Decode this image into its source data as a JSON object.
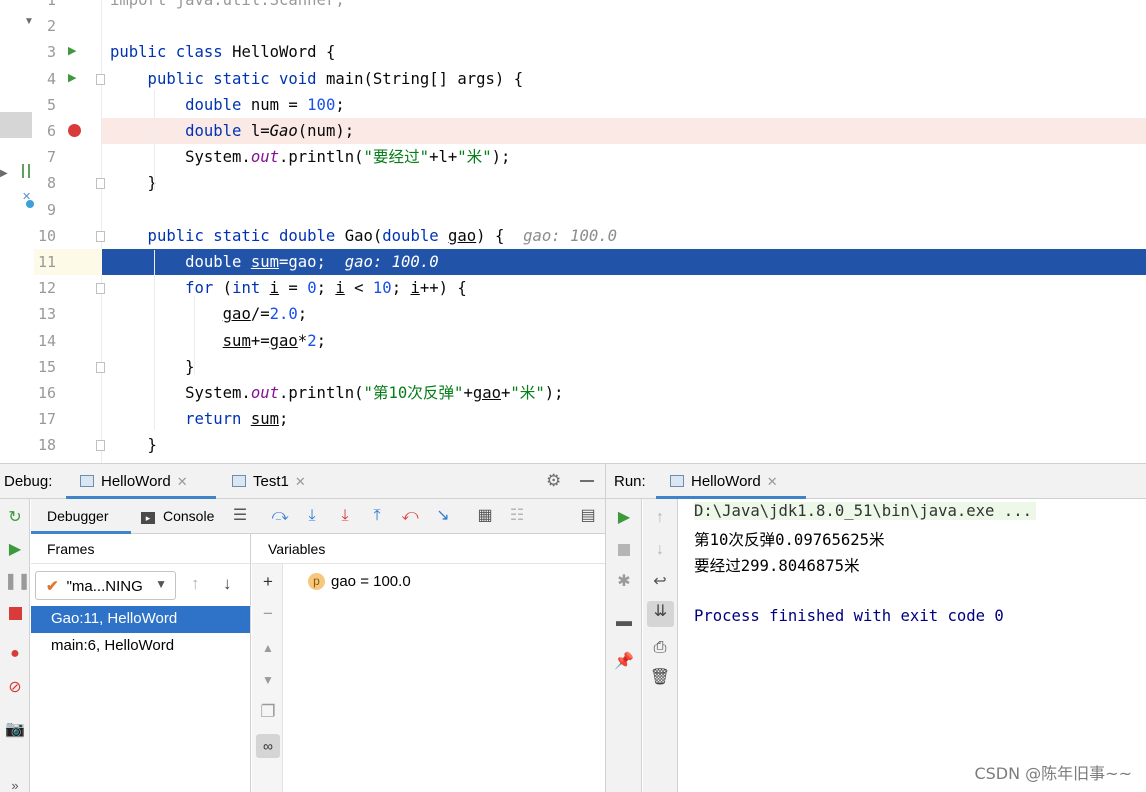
{
  "editor": {
    "lines": [
      {
        "n": "1",
        "tokens": [
          {
            "t": "import java.util.Scanner;",
            "c": "dim"
          }
        ]
      },
      {
        "n": "2",
        "tokens": []
      },
      {
        "n": "3",
        "tokens": [
          {
            "t": "public class ",
            "c": "kw"
          },
          {
            "t": "HelloWord {",
            "c": ""
          }
        ]
      },
      {
        "n": "4",
        "tokens": [
          {
            "t": "    public static void ",
            "c": "kw"
          },
          {
            "t": "main",
            "c": ""
          },
          {
            "t": "(String[] args) {",
            "c": ""
          }
        ]
      },
      {
        "n": "5",
        "tokens": [
          {
            "t": "        double ",
            "c": "kw"
          },
          {
            "t": "num = ",
            "c": ""
          },
          {
            "t": "100",
            "c": "num"
          },
          {
            "t": ";",
            "c": ""
          }
        ]
      },
      {
        "n": "6",
        "tokens": [
          {
            "t": "        double ",
            "c": "kw"
          },
          {
            "t": "l=",
            "c": ""
          },
          {
            "t": "Gao",
            "c": "ital"
          },
          {
            "t": "(num);",
            "c": ""
          }
        ]
      },
      {
        "n": "7",
        "tokens": [
          {
            "t": "        System.",
            "c": ""
          },
          {
            "t": "out",
            "c": "fld"
          },
          {
            "t": ".println(",
            "c": ""
          },
          {
            "t": "\"要经过\"",
            "c": "str"
          },
          {
            "t": "+l+",
            "c": ""
          },
          {
            "t": "\"米\"",
            "c": "str"
          },
          {
            "t": ");",
            "c": ""
          }
        ]
      },
      {
        "n": "8",
        "tokens": [
          {
            "t": "    }",
            "c": ""
          }
        ]
      },
      {
        "n": "9",
        "tokens": []
      },
      {
        "n": "10",
        "tokens": [
          {
            "t": "    public static double ",
            "c": "kw"
          },
          {
            "t": "Gao",
            "c": ""
          },
          {
            "t": "(",
            "c": ""
          },
          {
            "t": "double ",
            "c": "kw"
          },
          {
            "t": "gao",
            "c": "ul"
          },
          {
            "t": ") {  ",
            "c": ""
          },
          {
            "t": "gao: 100.0",
            "c": "hint"
          }
        ]
      },
      {
        "n": "11",
        "tokens": [
          {
            "t": "        double ",
            "c": "kw"
          },
          {
            "t": "sum",
            "c": "ul"
          },
          {
            "t": "=gao;  ",
            "c": ""
          },
          {
            "t": "gao: 100.0",
            "c": "hint"
          }
        ]
      },
      {
        "n": "12",
        "tokens": [
          {
            "t": "        for ",
            "c": "kw"
          },
          {
            "t": "(",
            "c": ""
          },
          {
            "t": "int ",
            "c": "kw"
          },
          {
            "t": "i",
            "c": "ul"
          },
          {
            "t": " = ",
            "c": ""
          },
          {
            "t": "0",
            "c": "num"
          },
          {
            "t": "; ",
            "c": ""
          },
          {
            "t": "i",
            "c": "ul"
          },
          {
            "t": " < ",
            "c": ""
          },
          {
            "t": "10",
            "c": "num"
          },
          {
            "t": "; ",
            "c": ""
          },
          {
            "t": "i",
            "c": "ul"
          },
          {
            "t": "++) {",
            "c": ""
          }
        ]
      },
      {
        "n": "13",
        "tokens": [
          {
            "t": "            ",
            "c": ""
          },
          {
            "t": "gao",
            "c": "ul"
          },
          {
            "t": "/=",
            "c": ""
          },
          {
            "t": "2.0",
            "c": "num"
          },
          {
            "t": ";",
            "c": ""
          }
        ]
      },
      {
        "n": "14",
        "tokens": [
          {
            "t": "            ",
            "c": ""
          },
          {
            "t": "sum",
            "c": "ul"
          },
          {
            "t": "+=",
            "c": ""
          },
          {
            "t": "gao",
            "c": "ul"
          },
          {
            "t": "*",
            "c": ""
          },
          {
            "t": "2",
            "c": "num"
          },
          {
            "t": ";",
            "c": ""
          }
        ]
      },
      {
        "n": "15",
        "tokens": [
          {
            "t": "        }",
            "c": ""
          }
        ]
      },
      {
        "n": "16",
        "tokens": [
          {
            "t": "        System.",
            "c": ""
          },
          {
            "t": "out",
            "c": "fld"
          },
          {
            "t": ".println(",
            "c": ""
          },
          {
            "t": "\"第10次反弹\"",
            "c": "str"
          },
          {
            "t": "+",
            "c": ""
          },
          {
            "t": "gao",
            "c": "ul"
          },
          {
            "t": "+",
            "c": ""
          },
          {
            "t": "\"米\"",
            "c": "str"
          },
          {
            "t": ");",
            "c": ""
          }
        ]
      },
      {
        "n": "17",
        "tokens": [
          {
            "t": "        return ",
            "c": "kw"
          },
          {
            "t": "sum",
            "c": "ul"
          },
          {
            "t": ";",
            "c": ""
          }
        ]
      },
      {
        "n": "18",
        "tokens": [
          {
            "t": "    }",
            "c": ""
          }
        ]
      }
    ],
    "breakpoint_line": "6",
    "current_line": "11",
    "colors": {
      "current_line_bg": "#2154a8",
      "breakpoint_bg": "#fae9e5",
      "keyword": "#0033b3",
      "number": "#1750eb",
      "string": "#067d17"
    }
  },
  "debug": {
    "title": "Debug:",
    "tabs": [
      {
        "label": "HelloWord"
      },
      {
        "label": "Test1"
      }
    ],
    "subtabs": {
      "debugger": "Debugger",
      "console": "Console"
    },
    "frames_header": "Frames",
    "thread_selector": "\"ma...NING",
    "frames": [
      {
        "label": "Gao:11, HelloWord"
      },
      {
        "label": "main:6, HelloWord"
      }
    ],
    "variables_header": "Variables",
    "variables": [
      {
        "badge": "p",
        "text": "gao = 100.0"
      }
    ]
  },
  "run": {
    "title": "Run:",
    "tab_label": "HelloWord",
    "console_lines": [
      "D:\\Java\\jdk1.8.0_51\\bin\\java.exe ...",
      "第10次反弹0.09765625米",
      "要经过299.8046875米",
      "",
      "Process finished with exit code 0"
    ]
  },
  "watermark": "CSDN @陈年旧事~~",
  "icons": {
    "resume": "play-icon",
    "pause": "pause-icon",
    "stop": "stop-icon",
    "settings": "gear-icon",
    "camera": "camera-icon"
  }
}
